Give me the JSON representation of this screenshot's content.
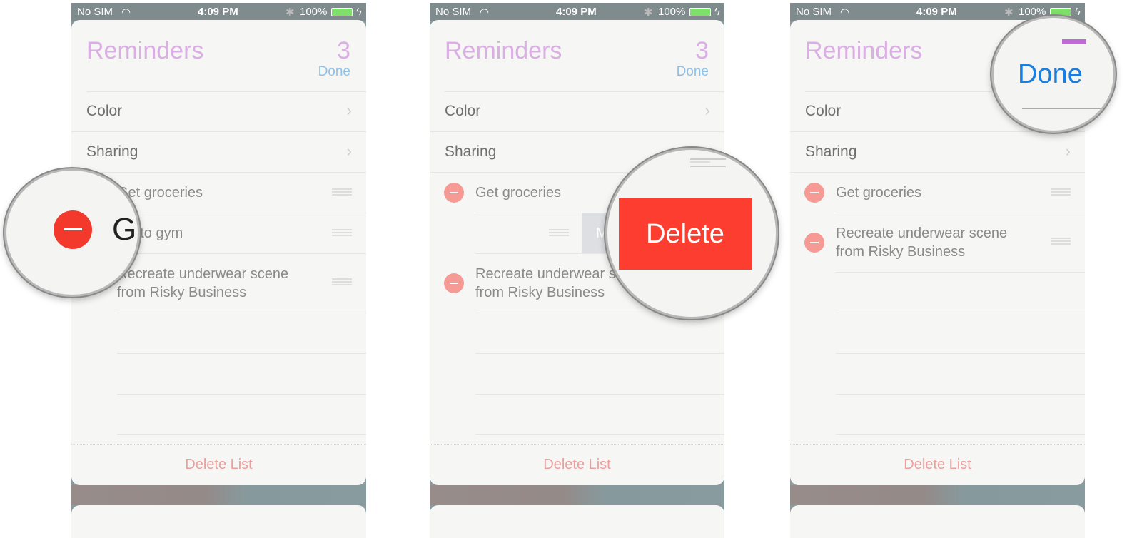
{
  "status_bar": {
    "carrier": "No SIM",
    "time": "4:09 PM",
    "battery": "100%"
  },
  "panels": [
    {
      "title": "Reminders",
      "count": "3",
      "done": "Done",
      "settings": [
        {
          "label": "Color"
        },
        {
          "label": "Sharing"
        }
      ],
      "items": [
        "Get groceries",
        "Go to gym",
        "Recreate underwear scene from Risky Business"
      ],
      "delete_list": "Delete List",
      "magnifier": {
        "text": "Go"
      }
    },
    {
      "title": "Reminders",
      "count": "3",
      "done": "Done",
      "settings": [
        {
          "label": "Color"
        },
        {
          "label": "Sharing"
        }
      ],
      "items": [
        "Get groceries",
        "Recreate underwear scene from Risky Business"
      ],
      "swipe_actions": {
        "more": "More",
        "delete": "Delete"
      },
      "delete_list": "Delete List"
    },
    {
      "title": "Reminders",
      "done": "Done",
      "settings": [
        {
          "label": "Color"
        },
        {
          "label": "Sharing"
        }
      ],
      "items": [
        "Get groceries",
        "Recreate underwear scene from Risky Business"
      ],
      "delete_list": "Delete List"
    }
  ],
  "colors": {
    "accent_purple": "#dcaee6",
    "done_blue": "#1a7ee0",
    "delete_red": "#fc3d2f"
  }
}
